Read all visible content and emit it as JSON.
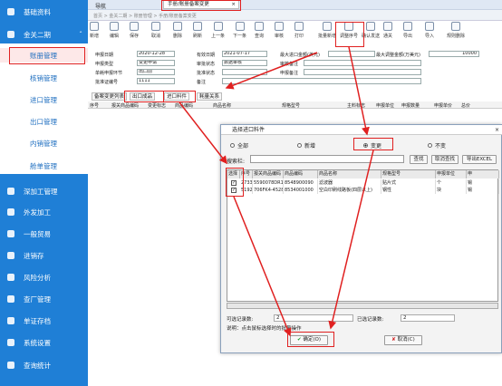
{
  "sidebar": {
    "items": [
      {
        "label": "基础资料"
      },
      {
        "label": "金关二期"
      },
      {
        "label": "深加工管理"
      },
      {
        "label": "外发加工"
      },
      {
        "label": "一般贸易"
      },
      {
        "label": "进销存"
      },
      {
        "label": "风险分析"
      },
      {
        "label": "查厂管理"
      },
      {
        "label": "单证存档"
      },
      {
        "label": "系统设置"
      },
      {
        "label": "查询统计"
      }
    ],
    "sub_items": [
      {
        "label": "账册管理"
      },
      {
        "label": "核销管理"
      },
      {
        "label": "进口管理"
      },
      {
        "label": "出口管理"
      },
      {
        "label": "内销管理"
      },
      {
        "label": "舱单管理"
      }
    ]
  },
  "topbar": {
    "nav_label": "导航",
    "active_tab": "手册/账册备案变更",
    "tab_close": "×"
  },
  "breadcrumb": "首页 > 金关二期 > 账册管理 > 手册/账册备案变更",
  "toolbar": [
    "新增",
    "编辑",
    "保存",
    "取消",
    "删除",
    "刷新",
    "上一条",
    "下一条",
    "查询",
    "审核",
    "打印",
    "批量新增",
    "调整序号",
    "确认发送",
    "通关",
    "导出",
    "导入",
    "规则删除"
  ],
  "form": {
    "apply_date_label": "申报日期",
    "apply_date": "2020-12-28",
    "valid_date_label": "有效日期",
    "valid_date": "2021-07-17",
    "max_import_label": "最大进口金额(美元)",
    "max_adjust_label": "最大调整金额(万美元)",
    "max_adjust": "10000",
    "apply_type_label": "申报类型",
    "apply_type": "变更申请",
    "review_status_label": "审批状态",
    "review_status": "数据审核",
    "review_note_label": "审核备注",
    "unit_label": "单耗申报环节",
    "unit": "出口前",
    "batch_status_label": "批准状态",
    "apply_note_label": "申报备注",
    "approve_no_label": "批准证编号",
    "approve_no": "1111",
    "remark_label": "备注"
  },
  "subtabs": [
    "备案变更列表",
    "出口成品",
    "进口料件",
    "耗量关系"
  ],
  "grid_headers": [
    "序号",
    "报关商品编码",
    "变更标志",
    "商品编码",
    "商品名称",
    "规格型号",
    "主料标志",
    "申报单位",
    "申报数量",
    "申报单价",
    "总价"
  ],
  "dialog": {
    "title": "选择进口料件",
    "radios": [
      {
        "label": "全部",
        "selected": false
      },
      {
        "label": "新增",
        "selected": false
      },
      {
        "label": "变更",
        "selected": true
      },
      {
        "label": "不变",
        "selected": false
      }
    ],
    "search_label": "搜索栏:",
    "buttons": [
      "查找",
      "取消查找",
      "导出EXCEL"
    ],
    "columns": [
      "选择",
      "序号",
      "报关商品编码",
      "商品编码",
      "商品名称",
      "规格型号",
      "申报单位",
      "申"
    ],
    "rows": [
      {
        "checked": true,
        "seq": "2733",
        "hs": "5590078DR1F",
        "code": "8548900090",
        "name": "滤波器",
        "spec": "贴片式",
        "unit": "个",
        "extra": "锡"
      },
      {
        "checked": true,
        "seq": "5192",
        "hs": "706FK4-4528-C",
        "code": "8534001000",
        "name": "空白印刷线路板(四层以上)",
        "spec": "钢性",
        "unit": "块",
        "extra": "锡"
      }
    ],
    "selectable_label": "可选记录数:",
    "selectable_count": "2",
    "selected_label": "已选记录数:",
    "selected_count": "2",
    "hint": "说明：点击鼠标选择时的批量操作",
    "ok_label": "确定(O)",
    "cancel_label": "取消(C)"
  },
  "colors": {
    "sidebar": "#1f7fd6",
    "highlight": "#e02020"
  }
}
